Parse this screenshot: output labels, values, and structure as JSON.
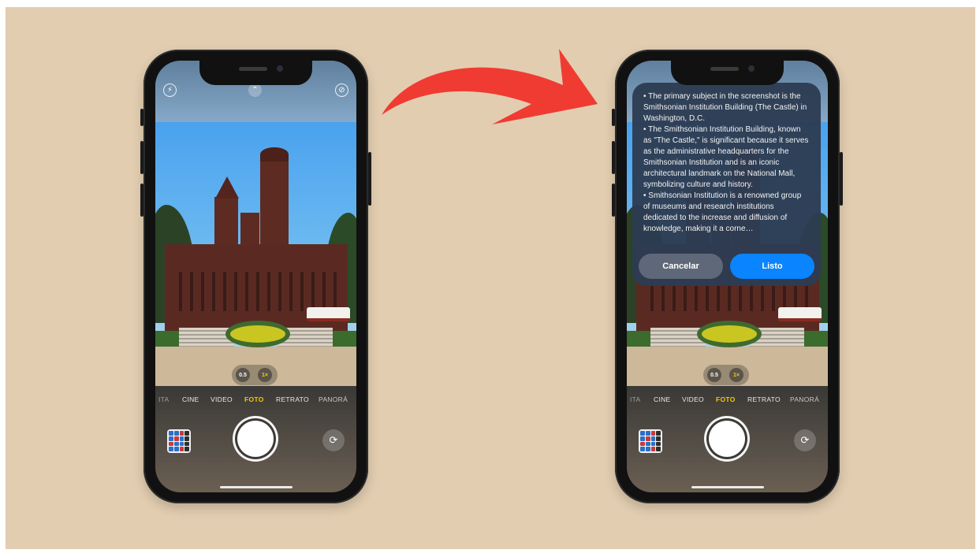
{
  "colors": {
    "background": "#e2cdb0",
    "arrow": "#f03b32",
    "active_mode": "#f5c400",
    "done_button": "#0a84ff"
  },
  "left_phone": {
    "top_icons": [
      "flash-icon",
      "chevron-up-icon",
      "live-photo-off-icon"
    ],
    "top_icon_glyphs": {
      "flash": "⚡",
      "chevron": "⌃",
      "live": "⊘"
    },
    "zoom": {
      "wide": "0.5",
      "main": "1×"
    },
    "modes": [
      "ITA",
      "CINE",
      "VIDEO",
      "FOTO",
      "RETRATO",
      "PANORÁ"
    ],
    "active_mode": "FOTO",
    "flip_glyph": "⟳"
  },
  "right_phone": {
    "zoom": {
      "wide": "0.5",
      "main": "1×"
    },
    "modes": [
      "ITA",
      "CINE",
      "VIDEO",
      "FOTO",
      "RETRATO",
      "PANORÁ"
    ],
    "active_mode": "FOTO",
    "flip_glyph": "⟳",
    "popup": {
      "lines": [
        "• The primary subject in the screenshot is the Smithsonian Institution Building (The Castle) in Washington, D.C.",
        "• The Smithsonian Institution Building, known as \"The Castle,\" is significant because it serves as the administrative headquarters for the Smithsonian Institution and is an iconic architectural landmark on the National Mall, symbolizing culture and history.",
        "• Smithsonian Institution is a renowned group of museums and research institutions dedicated to the increase and diffusion of knowledge, making it a corne…"
      ],
      "cancel_label": "Cancelar",
      "done_label": "Listo"
    }
  }
}
